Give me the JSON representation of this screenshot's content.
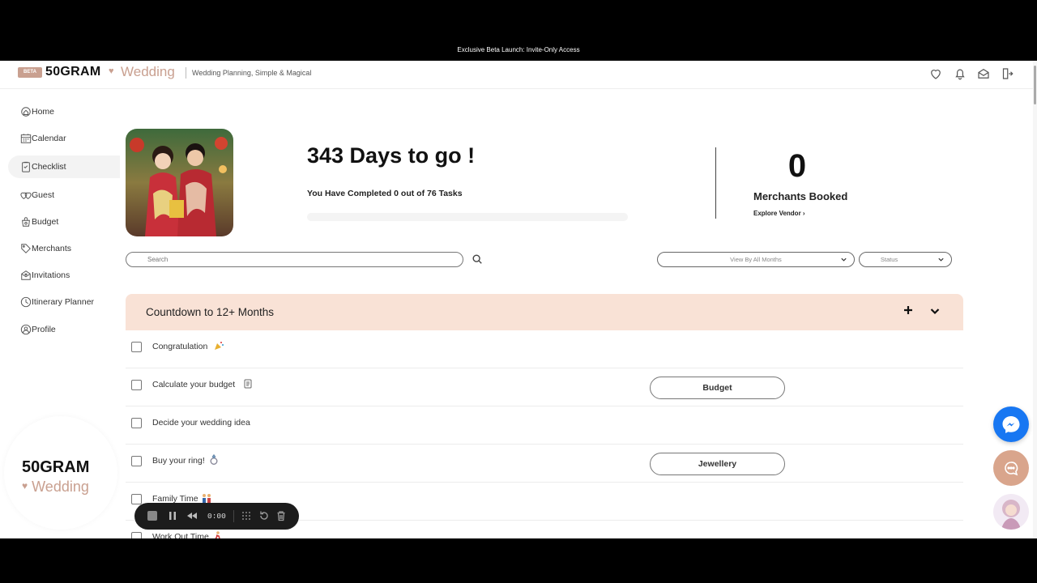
{
  "banner": {
    "text": "Exclusive Beta Launch: Invite-Only Access"
  },
  "header": {
    "badge": "BETA",
    "brand_main": "50GRAM",
    "brand_sub": "Wedding",
    "tagline": "Wedding Planning, Simple & Magical",
    "icons": [
      "heart-icon",
      "bell-icon",
      "mail-icon",
      "logout-icon"
    ]
  },
  "sidebar": {
    "items": [
      {
        "label": "Home",
        "icon": "home-icon"
      },
      {
        "label": "Calendar",
        "icon": "calendar-icon"
      },
      {
        "label": "Checklist",
        "icon": "checklist-icon",
        "active": true
      },
      {
        "label": "Guest",
        "icon": "guest-icon"
      },
      {
        "label": "Budget",
        "icon": "budget-icon"
      },
      {
        "label": "Merchants",
        "icon": "merchants-icon"
      },
      {
        "label": "Invitations",
        "icon": "invitations-icon"
      },
      {
        "label": "Itinerary Planner",
        "icon": "itinerary-icon"
      },
      {
        "label": "Profile",
        "icon": "profile-icon"
      }
    ],
    "logo_main": "50GRAM",
    "logo_sub": "Wedding"
  },
  "summary": {
    "days_to_go": "343 Days to go !",
    "completed_text": "You Have Completed 0 out of 76 Tasks",
    "progress_fraction": 0,
    "merchants_count": "0",
    "merchants_label": "Merchants Booked",
    "explore_link": "Explore Vendor ›"
  },
  "filters": {
    "search_placeholder": "Search",
    "view_by": "View By All Months",
    "status": "Status"
  },
  "section": {
    "title": "Countdown to 12+ Months",
    "tasks": [
      {
        "label": "Congratulation",
        "emoji": "party-popper-icon",
        "button": ""
      },
      {
        "label": "Calculate your budget",
        "emoji": "scroll-icon",
        "button": "Budget"
      },
      {
        "label": "Decide your wedding idea",
        "emoji": "",
        "button": ""
      },
      {
        "label": "Buy your ring!",
        "emoji": "ring-icon",
        "button": "Jewellery"
      },
      {
        "label": "Family Time",
        "emoji": "family-icon",
        "button": ""
      },
      {
        "label": "Work Out Time",
        "emoji": "runner-icon",
        "button": ""
      }
    ]
  },
  "recorder": {
    "time": "0:00"
  },
  "colors": {
    "accent": "#c9a090",
    "section_bg": "#f9e2d6",
    "messenger": "#1877f2"
  }
}
